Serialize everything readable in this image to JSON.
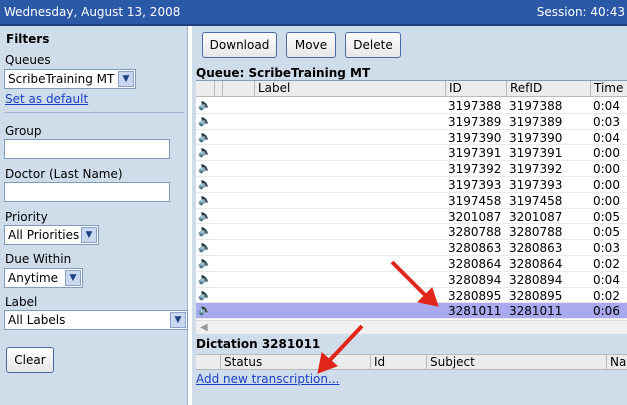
{
  "header": {
    "date": "Wednesday, August 13, 2008",
    "session": "Session: 40:43"
  },
  "filters": {
    "title": "Filters",
    "queues_label": "Queues",
    "queues_value": "ScribeTraining MT",
    "set_default": "Set as default",
    "group_label": "Group",
    "doctor_label": "Doctor (Last Name)",
    "priority_label": "Priority",
    "priority_value": "All Priorities",
    "due_label": "Due Within",
    "due_value": "Anytime",
    "label_label": "Label",
    "label_value": "All Labels",
    "clear": "Clear"
  },
  "toolbar": {
    "download": "Download",
    "move": "Move",
    "delete": "Delete"
  },
  "queue": {
    "title": "Queue: ScribeTraining MT",
    "columns": {
      "label": "Label",
      "id": "ID",
      "refid": "RefID",
      "time": "Time"
    },
    "rows": [
      {
        "id": "3197388",
        "refid": "3197388",
        "time": "0:04"
      },
      {
        "id": "3197389",
        "refid": "3197389",
        "time": "0:03"
      },
      {
        "id": "3197390",
        "refid": "3197390",
        "time": "0:04"
      },
      {
        "id": "3197391",
        "refid": "3197391",
        "time": "0:00"
      },
      {
        "id": "3197392",
        "refid": "3197392",
        "time": "0:00"
      },
      {
        "id": "3197393",
        "refid": "3197393",
        "time": "0:00"
      },
      {
        "id": "3197458",
        "refid": "3197458",
        "time": "0:00"
      },
      {
        "id": "3201087",
        "refid": "3201087",
        "time": "0:05"
      },
      {
        "id": "3280788",
        "refid": "3280788",
        "time": "0:05"
      },
      {
        "id": "3280863",
        "refid": "3280863",
        "time": "0:03"
      },
      {
        "id": "3280864",
        "refid": "3280864",
        "time": "0:02"
      },
      {
        "id": "3280894",
        "refid": "3280894",
        "time": "0:04"
      },
      {
        "id": "3280895",
        "refid": "3280895",
        "time": "0:02"
      },
      {
        "id": "3281011",
        "refid": "3281011",
        "time": "0:06"
      }
    ],
    "selected_index": 13
  },
  "dictation": {
    "title": "Dictation 3281011",
    "columns": {
      "status": "Status",
      "id": "Id",
      "subject": "Subject",
      "na": "Na"
    },
    "add_link": "Add new transcription..."
  },
  "colors": {
    "header": "#2b59a8",
    "panel": "#cfddea",
    "selected_row": "#a9a9ef",
    "annotation": "#e0261b"
  }
}
